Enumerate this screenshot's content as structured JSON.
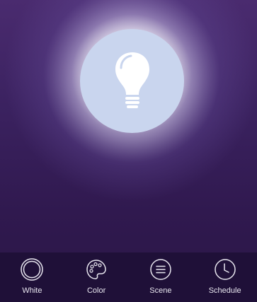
{
  "bulb": {
    "icon": "lightbulb-icon",
    "fill_color": "#c9d5ee",
    "bulb_color": "#ffffff"
  },
  "tabs": [
    {
      "label": "White",
      "icon": "white-ring-icon"
    },
    {
      "label": "Color",
      "icon": "palette-icon"
    },
    {
      "label": "Scene",
      "icon": "scene-list-icon"
    },
    {
      "label": "Schedule",
      "icon": "clock-icon"
    }
  ],
  "colors": {
    "background_top": "#4a2b6f",
    "background_bottom": "#2a1646",
    "tab_bar": "#1f1038",
    "tab_text": "#e8e6ef"
  }
}
